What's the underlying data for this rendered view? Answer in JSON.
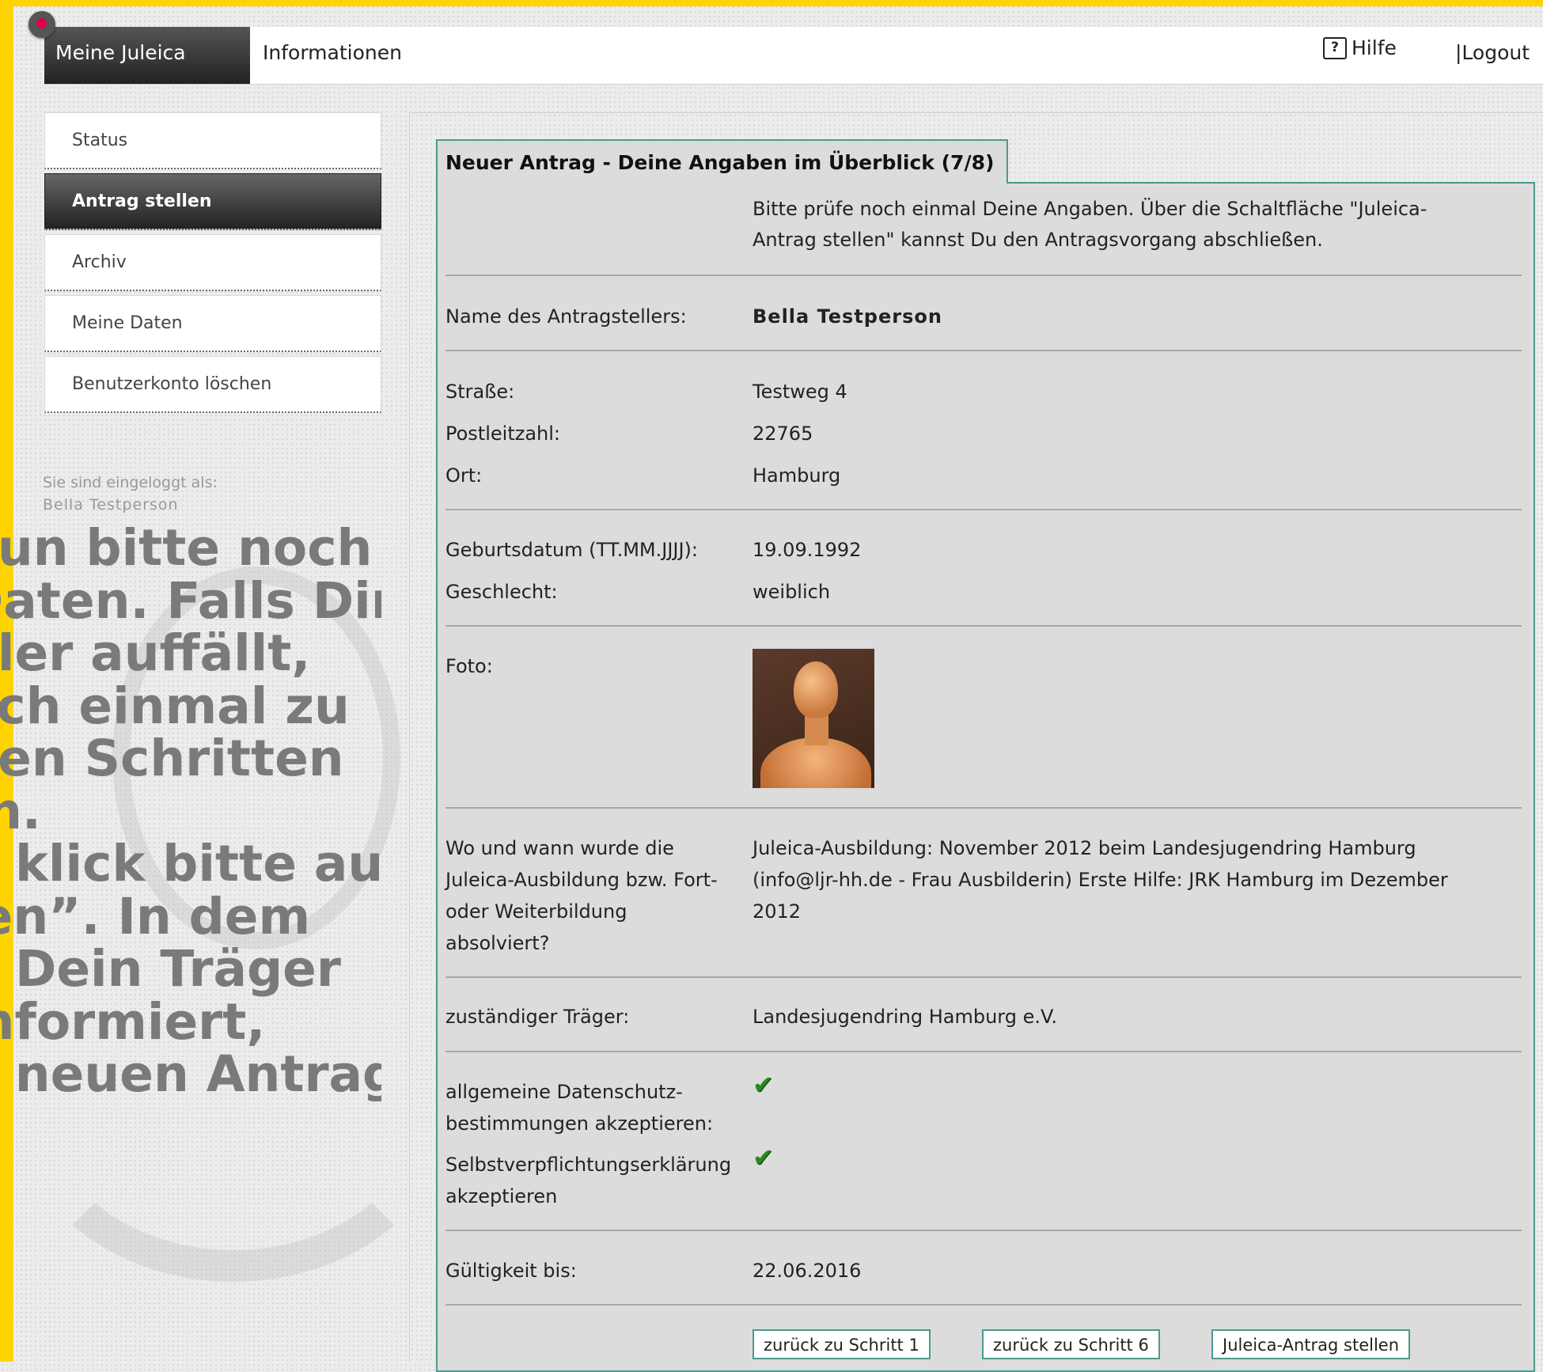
{
  "nav": {
    "tab_active": "Meine Juleica",
    "tab_info": "Informationen",
    "help": "Hilfe",
    "help_icon": "?",
    "logout": "|Logout"
  },
  "sidebar": {
    "items": [
      {
        "label": "Status"
      },
      {
        "label": "Antrag stellen"
      },
      {
        "label": "Archiv"
      },
      {
        "label": "Meine Daten"
      },
      {
        "label": "Benutzerkonto löschen"
      }
    ],
    "active_index": 1,
    "logged_label": "Sie sind eingeloggt als:",
    "logged_user": "Bella Testperson"
  },
  "overlay_text": [
    "nun bitte noch",
    "Daten. Falls Dir",
    "hler auffällt,",
    "och einmal zu",
    "gen Schritten",
    "rn.",
    "d klick bitte auf",
    "len”. In dem",
    "d Dein Träger",
    " informiert,",
    "n neuen Antrag"
  ],
  "form": {
    "title": "Neuer Antrag - Deine Angaben im Überblick (7/8)",
    "intro_line1": "Bitte prüfe noch einmal Deine Angaben. Über die Schaltfläche \"Juleica-",
    "intro_line2": "Antrag stellen\" kannst Du den Antragsvorgang abschließen.",
    "name_label": "Name des Antragstellers:",
    "name_value": "Bella Testperson",
    "street_label": "Straße:",
    "street_value": "Testweg 4",
    "zip_label": "Postleitzahl:",
    "zip_value": "22765",
    "city_label": "Ort:",
    "city_value": "Hamburg",
    "birth_label": "Geburtsdatum (TT.MM.JJJJ):",
    "birth_value": "19.09.1992",
    "gender_label": "Geschlecht:",
    "gender_value": "weiblich",
    "photo_label": "Foto:",
    "training_label_1": "Wo und wann wurde die",
    "training_label_2": "Juleica-Ausbildung bzw. Fort-",
    "training_label_3": "oder Weiterbildung",
    "training_label_4": "absolviert?",
    "training_value_1": "Juleica-Ausbildung: November 2012 beim Landesjugendring Hamburg",
    "training_value_2": "(info@ljr-hh.de - Frau Ausbilderin) Erste Hilfe: JRK Hamburg im Dezember",
    "training_value_3": "2012",
    "carrier_label": "zuständiger Träger:",
    "carrier_value": "Landesjugendring Hamburg e.V.",
    "privacy_label_1": "allgemeine Datenschutz-",
    "privacy_label_2": "bestimmungen akzeptieren:",
    "privacy_check": "✔",
    "commitment_label_1": "Selbstverpflichtungserklärung",
    "commitment_label_2": "akzeptieren",
    "commitment_check": "✔",
    "validity_label": "Gültigkeit bis:",
    "validity_value": "22.06.2016"
  },
  "buttons": {
    "back1": "zurück zu Schritt 1",
    "back6": "zurück zu Schritt 6",
    "submit": "Juleica-Antrag stellen"
  },
  "colors": {
    "accent_yellow": "#ffd400",
    "teal_border": "#4a9a8e",
    "check_green": "#2a8a1e",
    "pin_magenta": "#e0004a"
  }
}
